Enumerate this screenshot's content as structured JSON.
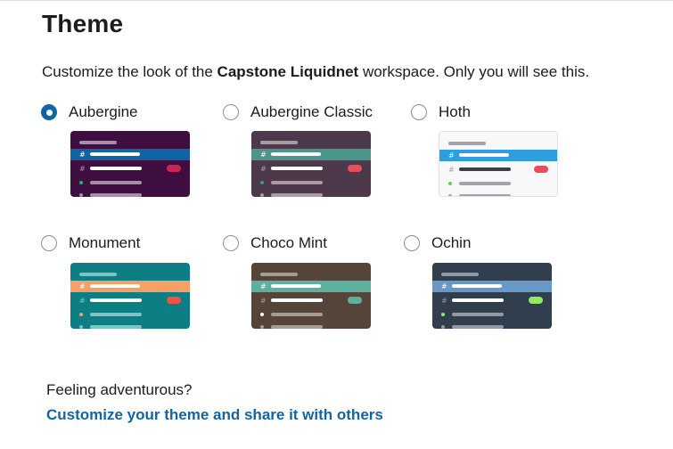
{
  "page": {
    "title": "Theme",
    "subtitle_pre": "Customize the look of the ",
    "workspace_name": "Capstone Liquidnet",
    "subtitle_post": " workspace. Only you will see this."
  },
  "themes": [
    {
      "label": "Aubergine",
      "selected": true,
      "colors": {
        "bg": "#3f0e40",
        "sel": "#1164a3",
        "text": "#ffffff",
        "muted": "#a58ea6",
        "pill": "#cd2553",
        "dot": "#2bac76"
      }
    },
    {
      "label": "Aubergine Classic",
      "selected": false,
      "colors": {
        "bg": "#4d394b",
        "sel": "#4c9689",
        "text": "#ffffff",
        "muted": "#a89ba6",
        "pill": "#eb4d5c",
        "dot": "#38978d"
      }
    },
    {
      "label": "Hoth",
      "selected": false,
      "colors": {
        "bg": "#f8f8fa",
        "sel": "#2d9ee0",
        "text": "#383f45",
        "muted": "#a0a3a7",
        "pill": "#eb4d5c",
        "dot": "#60d156",
        "border": "#e2e2e4"
      }
    },
    {
      "label": "Monument",
      "selected": false,
      "colors": {
        "bg": "#0d7e83",
        "sel": "#f79f66",
        "text": "#ffffff",
        "muted": "#7ec3c4",
        "pill": "#f15340",
        "dot": "#f79f66"
      }
    },
    {
      "label": "Choco Mint",
      "selected": false,
      "colors": {
        "bg": "#544538",
        "sel": "#5db09d",
        "text": "#ffffff",
        "muted": "#a59d94",
        "pill": "#5db09d",
        "dot": "#ffffff"
      }
    },
    {
      "label": "Ochin",
      "selected": false,
      "colors": {
        "bg": "#303e4d",
        "sel": "#6698c8",
        "text": "#ffffff",
        "muted": "#8f9aa5",
        "pill": "#94e864",
        "dot": "#94e864"
      }
    }
  ],
  "footer": {
    "prompt": "Feeling adventurous?",
    "link": "Customize your theme and share it with others"
  }
}
